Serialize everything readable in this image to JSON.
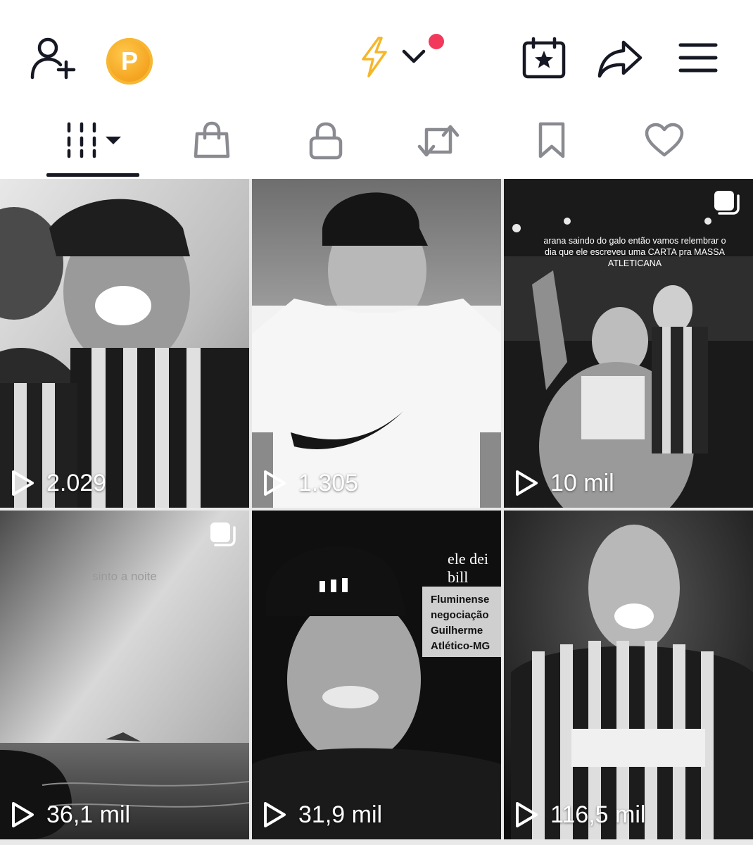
{
  "header": {
    "add_user_icon": "add-user-icon",
    "coin_icon": "coin-icon",
    "coin_letter": "P",
    "bolt_icon": "lightning-icon",
    "chevron_icon": "chevron-down-icon",
    "calendar_icon": "calendar-star-icon",
    "share_icon": "share-arrow-icon",
    "menu_icon": "hamburger-menu-icon",
    "colors": {
      "bolt": "#f5b72a",
      "coin": "#f5a623",
      "notification_dot": "#f2395b"
    }
  },
  "tabs": [
    {
      "id": "videos",
      "icon": "videos-grid-icon",
      "selected": true,
      "has_dropdown": true
    },
    {
      "id": "shop",
      "icon": "shopping-bag-icon",
      "selected": false
    },
    {
      "id": "private",
      "icon": "lock-icon",
      "selected": false
    },
    {
      "id": "reposts",
      "icon": "repost-icon",
      "selected": false
    },
    {
      "id": "saved",
      "icon": "bookmark-icon",
      "selected": false
    },
    {
      "id": "liked",
      "icon": "heart-icon",
      "selected": false
    }
  ],
  "grid": {
    "videos": [
      {
        "views": "2.029",
        "carousel": false
      },
      {
        "views": "1.305",
        "carousel": false
      },
      {
        "views": "10 mil",
        "carousel": true,
        "caption": "arana saindo do galo então vamos relembrar o dia que ele escreveu uma CARTA pra MASSA ATLETICANA"
      },
      {
        "views": "36,1 mil",
        "carousel": true,
        "caption": "sinto a noite"
      },
      {
        "views": "31,9 mil",
        "carousel": false,
        "caption": "ele dei bill",
        "subcaption": "Fluminense negociação Guilherme Atlético-MG"
      },
      {
        "views": "116,5 mil",
        "carousel": false
      }
    ],
    "play_icon": "play-icon",
    "carousel_icon": "carousel-icon"
  }
}
